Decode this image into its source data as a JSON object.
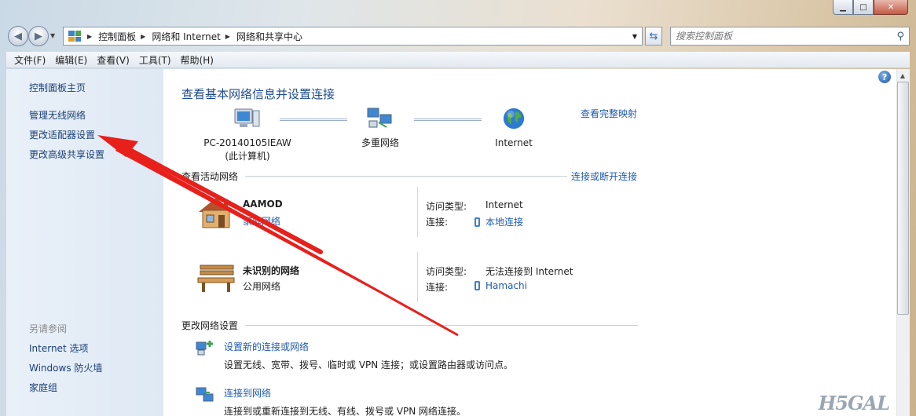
{
  "window": {
    "minimize": "▁",
    "maximize": "□",
    "close": "✕"
  },
  "navigation": {
    "back_icon": "left-arrow-icon",
    "forward_icon": "right-arrow-icon",
    "breadcrumbs": [
      "控制面板",
      "网络和 Internet",
      "网络和共享中心"
    ],
    "search_placeholder": "搜索控制面板"
  },
  "menu": [
    "文件(F)",
    "编辑(E)",
    "查看(V)",
    "工具(T)",
    "帮助(H)"
  ],
  "sidebar": {
    "links": [
      "控制面板主页",
      "管理无线网络",
      "更改适配器设置",
      "更改高级共享设置"
    ],
    "see_also_header": "另请参阅",
    "see_also": [
      "Internet 选项",
      "Windows 防火墙",
      "家庭组"
    ]
  },
  "main": {
    "title": "查看基本网络信息并设置连接",
    "full_map_link": "查看完整映射",
    "nodes": [
      {
        "name": "PC-20140105IEAW",
        "sub": "(此计算机)"
      },
      {
        "name": "多重网络",
        "sub": ""
      },
      {
        "name": "Internet",
        "sub": ""
      }
    ],
    "active_header": "查看活动网络",
    "connect_link": "连接或断开连接",
    "networks": [
      {
        "name": "AAMOD",
        "type": "家庭网络",
        "type_is_link": true,
        "access_label": "访问类型:",
        "access_value": "Internet",
        "conn_label": "连接:",
        "conn_value": "本地连接"
      },
      {
        "name": "未识别的网络",
        "type": "公用网络",
        "type_is_link": false,
        "access_label": "访问类型:",
        "access_value": "无法连接到 Internet",
        "conn_label": "连接:",
        "conn_value": "Hamachi"
      }
    ],
    "change_header": "更改网络设置",
    "tasks": [
      {
        "link": "设置新的连接或网络",
        "desc": "设置无线、宽带、拨号、临时或 VPN 连接；或设置路由器或访问点。"
      },
      {
        "link": "连接到网络",
        "desc": "连接到或重新连接到无线、有线、拨号或 VPN 网络连接。"
      }
    ]
  },
  "watermark": "H5GAL",
  "colors": {
    "link": "#1f5bb0",
    "title": "#1e4b8f",
    "arrow": "#e8201c"
  }
}
